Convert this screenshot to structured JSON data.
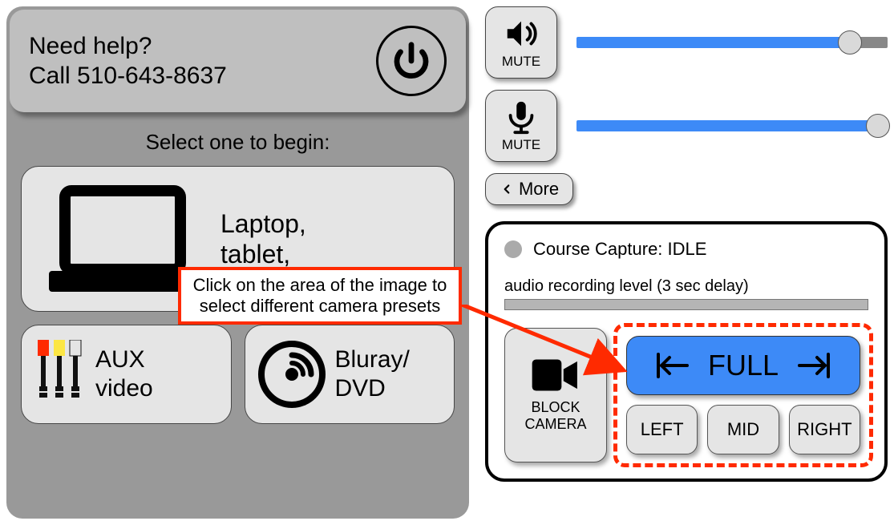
{
  "help": {
    "line1": "Need help?",
    "line2": "Call 510-643-8637"
  },
  "select_label": "Select one to begin:",
  "sources": {
    "laptop": "Laptop,\ntablet,",
    "aux": "AUX\nvideo",
    "bluray": "Bluray/\nDVD"
  },
  "audio": {
    "mute_speaker": "MUTE",
    "mute_mic": "MUTE",
    "speaker_pct": "88%",
    "mic_pct": "97%",
    "more": "More"
  },
  "capture": {
    "status": "Course Capture: IDLE",
    "rec_label": "audio recording level (3 sec delay)",
    "block": "BLOCK\nCAMERA",
    "full": "FULL",
    "left": "LEFT",
    "mid": "MID",
    "right": "RIGHT"
  },
  "callout": "Click on the area of the image to select different camera presets"
}
